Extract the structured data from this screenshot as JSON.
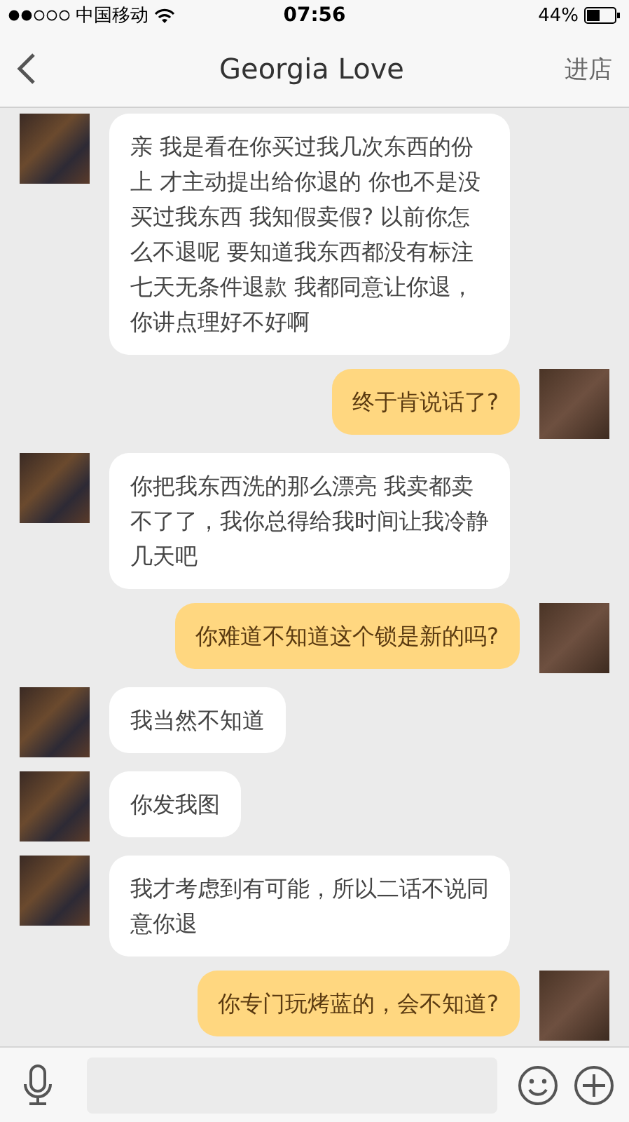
{
  "status_bar": {
    "carrier": "中国移动",
    "time": "07:56",
    "battery": "44%"
  },
  "nav": {
    "title": "Georgia Love",
    "action": "进店"
  },
  "messages": [
    {
      "kind": "incoming",
      "text": "亲 我是看在你买过我几次东西的份上  才主动提出给你退的  你也不是没买过我东西 我知假卖假? 以前你怎么不退呢 要知道我东西都没有标注七天无条件退款 我都同意让你退，你讲点理好不好啊"
    },
    {
      "kind": "outgoing",
      "text": "终于肯说话了?"
    },
    {
      "kind": "incoming",
      "text": "你把我东西洗的那么漂亮 我卖都卖不了了，我你总得给我时间让我冷静几天吧"
    },
    {
      "kind": "outgoing",
      "text": "你难道不知道这个锁是新的吗?"
    },
    {
      "kind": "incoming",
      "text": "我当然不知道"
    },
    {
      "kind": "incoming",
      "text": "你发我图"
    },
    {
      "kind": "incoming",
      "text": "我才考虑到有可能，所以二话不说同意你退"
    },
    {
      "kind": "outgoing",
      "text": "你专门玩烤蓝的，会不知道?"
    }
  ]
}
